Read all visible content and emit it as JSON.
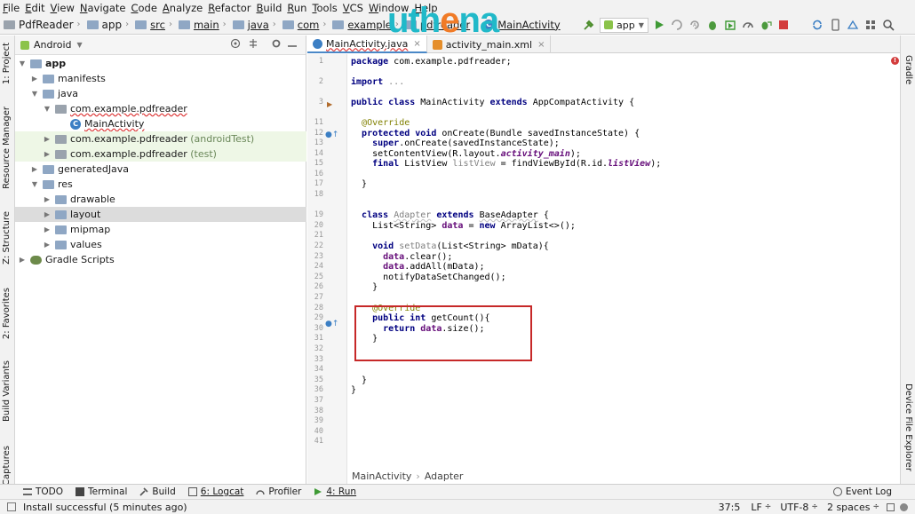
{
  "menu": [
    "File",
    "Edit",
    "View",
    "Navigate",
    "Code",
    "Analyze",
    "Refactor",
    "Build",
    "Run",
    "Tools",
    "VCS",
    "Window",
    "Help"
  ],
  "breadcrumb": [
    "PdfReader",
    "app",
    "src",
    "main",
    "java",
    "com",
    "example",
    "pdfreader",
    "MainActivity"
  ],
  "logo": {
    "part1": "uth",
    "part2": "e",
    "part3": "na"
  },
  "toolbar": {
    "run_config": "app"
  },
  "left_tabs": {
    "project": "1: Project",
    "resource_manager": "Resource Manager",
    "structure": "Z: Structure",
    "favorites": "2: Favorites",
    "build_variants": "Build Variants",
    "captures": "Captures"
  },
  "right_tabs": {
    "gradle": "Gradle",
    "device_explorer": "Device File Explorer"
  },
  "project": {
    "view_label": "Android",
    "tree": [
      {
        "label": "app"
      },
      {
        "label": "manifests"
      },
      {
        "label": "java"
      },
      {
        "label": "com.example.pdfreader"
      },
      {
        "label": "MainActivity"
      },
      {
        "label": "com.example.pdfreader",
        "suffix": "(androidTest)"
      },
      {
        "label": "com.example.pdfreader",
        "suffix": "(test)"
      },
      {
        "label": "generatedJava"
      },
      {
        "label": "res"
      },
      {
        "label": "drawable"
      },
      {
        "label": "layout"
      },
      {
        "label": "mipmap"
      },
      {
        "label": "values"
      },
      {
        "label": "Gradle Scripts"
      }
    ]
  },
  "editor": {
    "tabs": [
      {
        "label": "MainActivity.java"
      },
      {
        "label": "activity_main.xml"
      }
    ],
    "line_numbers": [
      "1",
      "2",
      "3",
      "11",
      "12",
      "13",
      "14",
      "15",
      "16",
      "17",
      "18",
      "19",
      "20",
      "21",
      "22",
      "23",
      "24",
      "25",
      "26",
      "27",
      "28",
      "29",
      "30",
      "31",
      "32",
      "33",
      "34",
      "35",
      "36",
      "37",
      "38",
      "39",
      "40",
      "41"
    ],
    "crumb": [
      "MainActivity",
      "Adapter"
    ]
  },
  "bottom_tabs": [
    "TODO",
    "Terminal",
    "Build",
    "6: Logcat",
    "Profiler",
    "4: Run",
    "Event Log"
  ],
  "status": {
    "message": "Install successful (5 minutes ago)",
    "position": "37:5",
    "line_sep": "LF",
    "encoding": "UTF-8",
    "indent": "2 spaces"
  }
}
